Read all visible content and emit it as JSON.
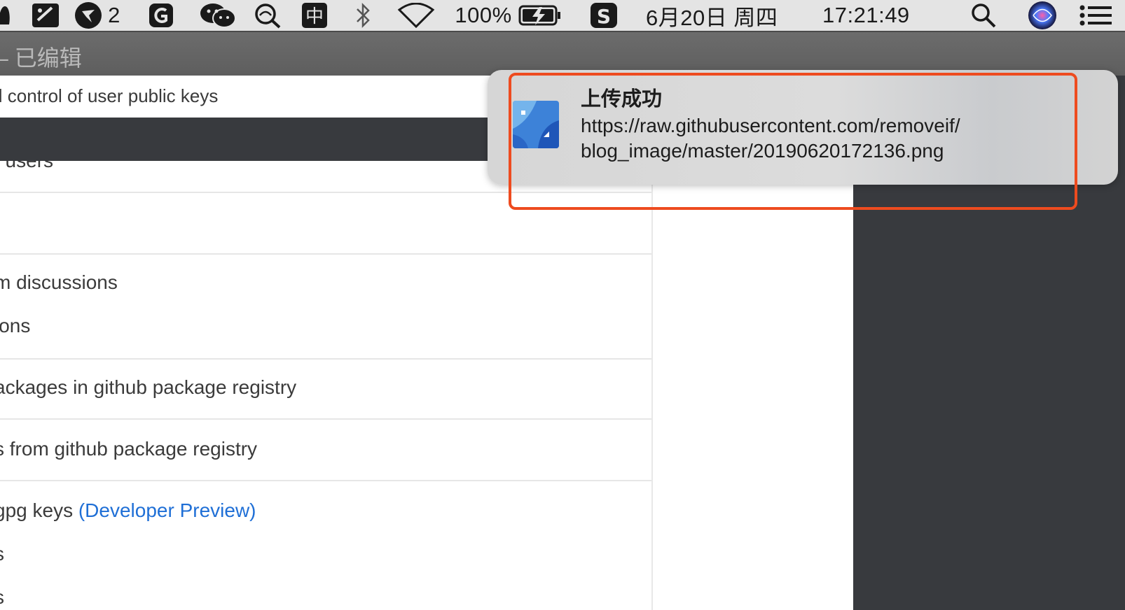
{
  "menubar": {
    "badge_count": "2",
    "battery_percent": "100%",
    "date": "6月20日 周四",
    "time": "17:21:49",
    "input_method_label": "中"
  },
  "window": {
    "title": "– 已编辑"
  },
  "scopes": {
    "top_row": "ll control of user public keys",
    "partial_row": "/ users",
    "discussions_1": "m discussions",
    "discussions_2": "ions",
    "packages_write": "ackages in github package registry",
    "packages_read": "s from github package registry",
    "gpg_prefix": " gpg keys ",
    "gpg_preview": "(Developer Preview)",
    "gpg_sub_1": "s",
    "gpg_sub_2": "s"
  },
  "notification": {
    "title": "上传成功",
    "url_line_1": "https://raw.githubusercontent.com/removeif/",
    "url_line_2": "blog_image/master/20190620172136.png"
  },
  "colors": {
    "highlight_box": "#ee4b1f",
    "link_blue": "#1f6fd6",
    "dark_panel": "#383a3e"
  }
}
